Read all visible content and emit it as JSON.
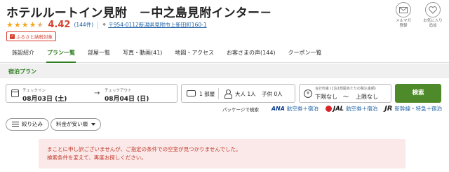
{
  "hotel": {
    "name": "ホテルルートイン見附　－中之島見附インター－",
    "rating": 4.42,
    "rating_display": "4.42",
    "review_count": "(144件)",
    "address": "〒954-0112新潟県見附市上新田町160-1",
    "badge": "ふるさと納税対象"
  },
  "top_icons": [
    {
      "icon": "mail-icon",
      "label": "メルマガ\n登録"
    },
    {
      "icon": "heart-icon",
      "label": "お気に入り\n追加"
    }
  ],
  "tabs": [
    "施設紹介",
    "プラン一覧",
    "部屋一覧",
    "写真・動画(41)",
    "地図・アクセス",
    "お客さまの声(144)",
    "クーポン一覧"
  ],
  "active_tab": "プラン一覧",
  "subtab": "宿泊プラン",
  "search": {
    "checkin_label": "チェックイン",
    "checkin_value": "08月03日 (土)",
    "checkout_label": "チェックアウト",
    "checkout_value": "08月04日 (日)",
    "rooms": "1 部屋",
    "adults": "大人 1人",
    "children": "子供 0人",
    "price_label": "合計料金",
    "price_sub": "(1泊1部屋あたりの税込金額)",
    "price_min": "下限なし",
    "price_tilde": "〜",
    "price_max": "上限なし",
    "search_button": "検索"
  },
  "package": {
    "label": "パッケージで検索",
    "items": [
      {
        "brand": "ANA",
        "link": "航空券＋宿泊"
      },
      {
        "brand": "JAL",
        "link": "航空券＋宿泊"
      },
      {
        "brand": "JR",
        "link": "新幹線・特急＋宿泊"
      }
    ]
  },
  "filters": {
    "narrow_label": "絞り込み",
    "sort_label": "料金が安い順"
  },
  "error": {
    "line1": "まことに申し訳ございませんが、ご指定の条件での空室が見つかりませんでした。",
    "line2": "検索条件を変えて、再度お探しください。"
  },
  "colors": {
    "accent_green": "#4f8a2a",
    "tab_green": "#2f7d1f",
    "price_red": "#d8412f",
    "link_blue": "#1b5fa5",
    "error_bg": "#fbe9e9"
  }
}
